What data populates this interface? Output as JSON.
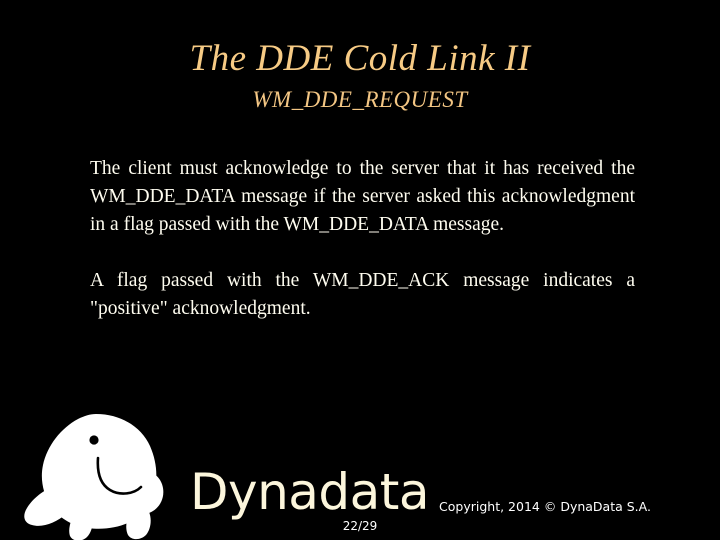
{
  "slide": {
    "background_color": "#000000",
    "title": "The DDE Cold Link II",
    "subtitle": "WM_DDE_REQUEST",
    "title_color": "#F7CB85",
    "body_color": "#FFFDF0",
    "paragraphs": [
      "The client must acknowledge to the server that it has received the WM_DDE_DATA message if the server asked this acknowledgment in a flag passed with the WM_DDE_DATA message.",
      "A flag passed with the WM_DDE_ACK message indicates a \"positive\" acknowledgment."
    ]
  },
  "footer": {
    "logo_icon": "manatee-logo-icon",
    "wordmark": "Dynadata",
    "wordmark_color": "#FCF6DC",
    "copyright": "Copyright, 2014 © DynaData S.A.",
    "page_number": "22/29"
  }
}
